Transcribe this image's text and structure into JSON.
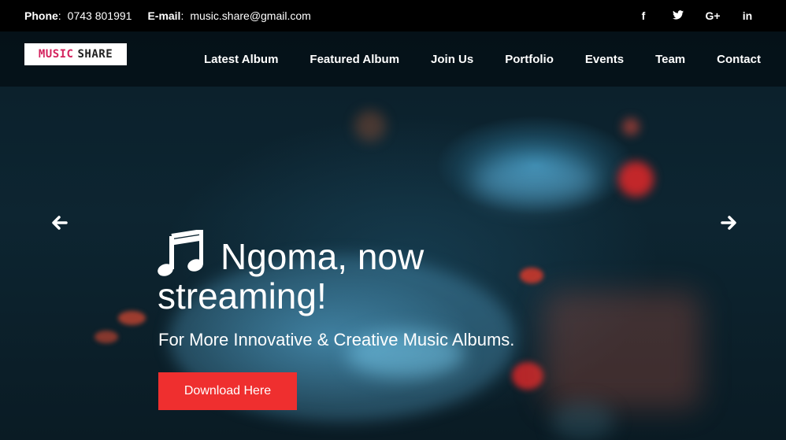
{
  "topbar": {
    "phone_label": "Phone",
    "phone_value": "0743 801991",
    "email_label": "E-mail",
    "email_value": "music.share@gmail.com",
    "social": [
      {
        "icon": "facebook-icon",
        "glyph": "f"
      },
      {
        "icon": "twitter-icon",
        "glyph": "t"
      },
      {
        "icon": "google-plus-icon",
        "glyph": "G+"
      },
      {
        "icon": "linkedin-icon",
        "glyph": "in"
      }
    ]
  },
  "brand": {
    "logo_part1": "MUSIC",
    "logo_part2": "SHARE",
    "logo_color": "#d4225e"
  },
  "nav": {
    "items": [
      "Latest Album",
      "Featured Album",
      "Join Us",
      "Portfolio",
      "Events",
      "Team",
      "Contact"
    ]
  },
  "hero": {
    "headline": "Ngoma, now streaming!",
    "subtitle": "For More Innovative & Creative Music Albums.",
    "cta_label": "Download Here",
    "cta_color": "#ef2f2f",
    "icons": {
      "prev": "arrow-left-icon",
      "next": "arrow-right-icon",
      "headline": "music-note-icon"
    }
  }
}
